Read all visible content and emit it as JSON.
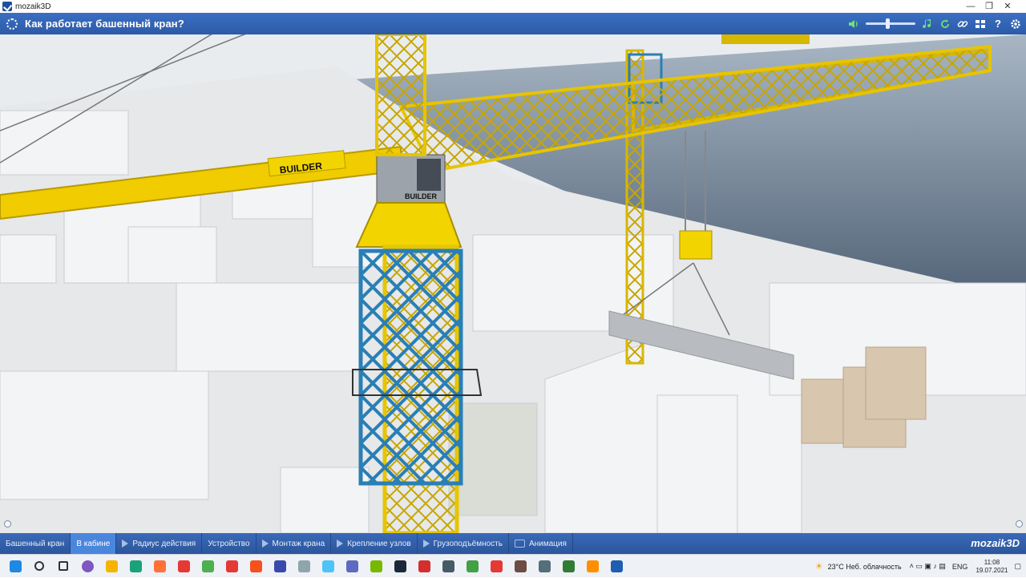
{
  "window": {
    "title": "mozaik3D",
    "minimize": "—",
    "restore": "❐",
    "close": "✕"
  },
  "header": {
    "title": "Как работает башенный кран?",
    "volume_level": 0.4,
    "tool_icons": [
      "speaker-icon",
      "volume-slider",
      "music-icon",
      "refresh-icon",
      "link-icon",
      "layout-icon",
      "help-icon",
      "settings-icon"
    ],
    "help_glyph": "?"
  },
  "scene": {
    "labels": {
      "boom_sign": "BUILDER",
      "cab_sign": "BUILDER"
    }
  },
  "tabs": [
    {
      "label": "Башенный кран",
      "icon": "none",
      "active": false
    },
    {
      "label": "В кабине",
      "icon": "none",
      "active": true
    },
    {
      "label": "Радиус действия",
      "icon": "play",
      "active": false
    },
    {
      "label": "Устройство",
      "icon": "none",
      "active": false
    },
    {
      "label": "Монтаж крана",
      "icon": "play",
      "active": false
    },
    {
      "label": "Крепление узлов",
      "icon": "play",
      "active": false
    },
    {
      "label": "Грузоподъёмность",
      "icon": "play",
      "active": false
    },
    {
      "label": "Анимация",
      "icon": "box",
      "active": false
    }
  ],
  "brand": "mozaik3D",
  "taskbar": {
    "apps": [
      {
        "name": "start-icon",
        "color": "#1e88e5"
      },
      {
        "name": "search-icon",
        "color": "#333333"
      },
      {
        "name": "task-view-icon",
        "color": "#333333"
      },
      {
        "name": "cortana-icon",
        "color": "#7e57c2"
      },
      {
        "name": "explorer-icon",
        "color": "#f6b400"
      },
      {
        "name": "edge-icon",
        "color": "#1aa37a"
      },
      {
        "name": "firefox-icon",
        "color": "#ff7139"
      },
      {
        "name": "yandex-icon",
        "color": "#e53935"
      },
      {
        "name": "chrome-icon",
        "color": "#4caf50"
      },
      {
        "name": "opera-icon",
        "color": "#e53935"
      },
      {
        "name": "slides-icon",
        "color": "#f4511e"
      },
      {
        "name": "edit-icon",
        "color": "#3949ab"
      },
      {
        "name": "paint-icon",
        "color": "#90a4ae"
      },
      {
        "name": "weather-app-icon",
        "color": "#4fc3f7"
      },
      {
        "name": "screen-icon",
        "color": "#5c6bc0"
      },
      {
        "name": "nvidia-icon",
        "color": "#76b900"
      },
      {
        "name": "steam-icon",
        "color": "#1b2838"
      },
      {
        "name": "ya-icon",
        "color": "#d32f2f"
      },
      {
        "name": "calc-icon",
        "color": "#455a64"
      },
      {
        "name": "globe-icon",
        "color": "#43a047"
      },
      {
        "name": "maps-icon",
        "color": "#e53935"
      },
      {
        "name": "book-icon",
        "color": "#6d4c41"
      },
      {
        "name": "camera-icon",
        "color": "#546e7a"
      },
      {
        "name": "green-app-icon",
        "color": "#2e7d32"
      },
      {
        "name": "vlc-icon",
        "color": "#ff8f00"
      },
      {
        "name": "mozaik-app-icon",
        "color": "#1e5db0"
      }
    ],
    "weather": "23°C  Неб. облачность",
    "lang": "ENG",
    "time": "11:08",
    "date": "19.07.2021"
  }
}
